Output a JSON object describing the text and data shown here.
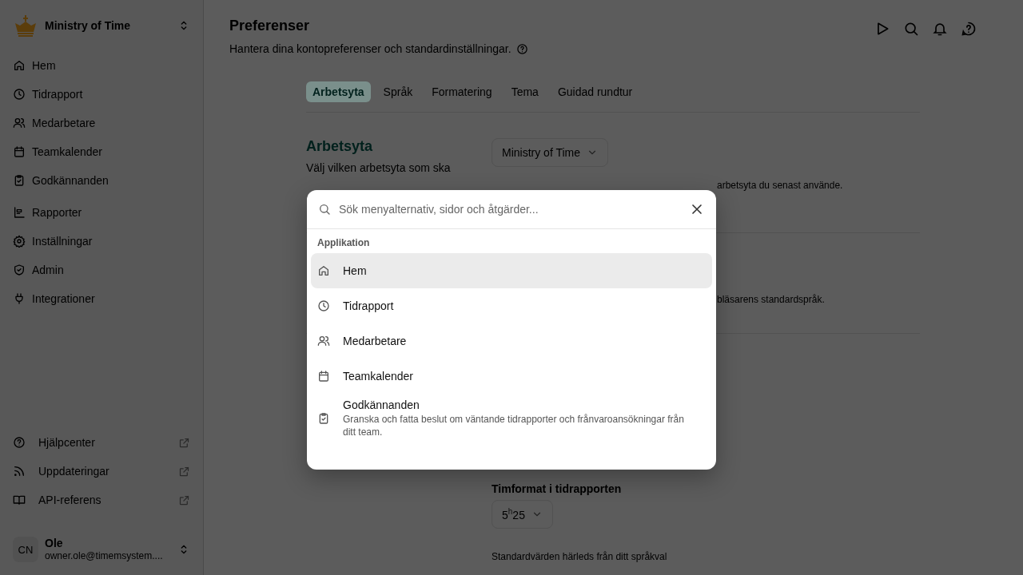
{
  "sidebar": {
    "workspace": "Ministry of Time",
    "items": [
      {
        "label": "Hem"
      },
      {
        "label": "Tidrapport"
      },
      {
        "label": "Medarbetare"
      },
      {
        "label": "Teamkalender"
      },
      {
        "label": "Godkännanden"
      },
      {
        "label": "Rapporter"
      },
      {
        "label": "Inställningar"
      },
      {
        "label": "Admin"
      },
      {
        "label": "Integrationer"
      }
    ],
    "links": [
      {
        "label": "Hjälpcenter"
      },
      {
        "label": "Uppdateringar"
      },
      {
        "label": "API-referens"
      }
    ],
    "user": {
      "initials": "CN",
      "name": "Ole",
      "email": "owner.ole@timemsystem...."
    }
  },
  "header": {
    "title": "Preferenser",
    "subtitle": "Hantera dina kontopreferenser och standardinställningar."
  },
  "tabs": [
    {
      "label": "Arbetsyta",
      "selected": true
    },
    {
      "label": "Språk",
      "selected": false
    },
    {
      "label": "Formatering",
      "selected": false
    },
    {
      "label": "Tema",
      "selected": false
    },
    {
      "label": "Guidad rundtur",
      "selected": false
    }
  ],
  "sections": [
    {
      "title": "Arbetsyta",
      "description": "Välj vilken arbetsyta som ska",
      "select": "Ministry of Time",
      "help": "arbetsyta du senast använde."
    },
    {
      "help": "bläsarens standardspråk."
    },
    {
      "label": "Timformat i tidrapporten",
      "select": "5$^{h}$25",
      "note": "Standardvärden härleds från ditt språkval"
    }
  ],
  "search_dialog": {
    "placeholder": "Sök menyalternativ, sidor och åtgärder...",
    "group": "Applikation",
    "items": [
      {
        "label": "Hem",
        "selected": true
      },
      {
        "label": "Tidrapport",
        "selected": false
      },
      {
        "label": "Medarbetare",
        "selected": false
      },
      {
        "label": "Teamkalender",
        "selected": false
      },
      {
        "label": "Godkännanden",
        "selected": false,
        "description": "Granska och fatta beslut om väntande tidrapporter och frånvaroansökningar från ditt team."
      }
    ]
  }
}
